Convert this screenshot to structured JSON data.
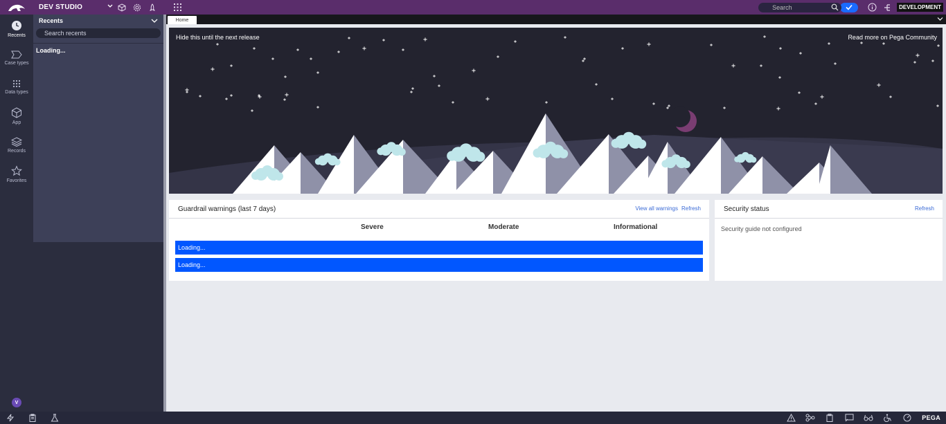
{
  "topbar": {
    "studio_label": "DEV STUDIO",
    "search_placeholder": "Search",
    "environment": "DEVELOPMENT"
  },
  "rail": {
    "items": [
      {
        "label": "Recents",
        "icon": "clock-icon",
        "active": true
      },
      {
        "label": "Case types",
        "icon": "case-type-icon",
        "active": false
      },
      {
        "label": "Data types",
        "icon": "grid-dots-icon",
        "active": false
      },
      {
        "label": "App",
        "icon": "cube-icon",
        "active": false
      },
      {
        "label": "Records",
        "icon": "layers-icon",
        "active": false
      },
      {
        "label": "Favorites",
        "icon": "star-icon",
        "active": false
      }
    ],
    "avatar_initial": "V"
  },
  "recents": {
    "title": "Recents",
    "search_placeholder": "Search recents",
    "loading_text": "Loading..."
  },
  "tabs": [
    {
      "label": "Home"
    }
  ],
  "hero": {
    "hide_link": "Hide this until the next release",
    "community_link": "Read more on Pega Community"
  },
  "guardrail": {
    "title": "Guardrail warnings (last 7 days)",
    "view_all": "View all warnings",
    "refresh": "Refresh",
    "columns": [
      "Severe",
      "Moderate",
      "Informational"
    ],
    "rows": [
      "Loading...",
      "Loading..."
    ]
  },
  "security": {
    "title": "Security status",
    "refresh": "Refresh",
    "message": "Security guide not configured"
  },
  "bottombar": {
    "brand": "PEGA"
  },
  "colors": {
    "header": "#5a2d6b",
    "rail": "#2b2d3e",
    "panel": "#3d4058",
    "accent": "#0157ff",
    "link": "#3b6bd6"
  }
}
